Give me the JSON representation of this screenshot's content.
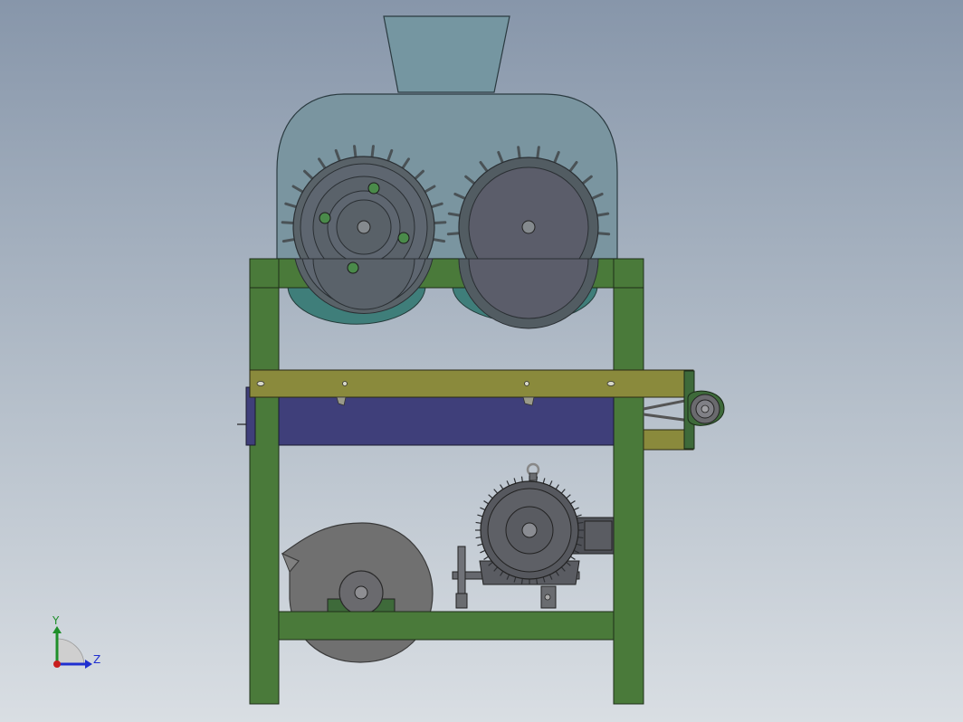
{
  "viewport": {
    "background_top": "#8796aa",
    "background_bottom": "#d9dee3"
  },
  "triad": {
    "y_label": "Y",
    "z_label": "Z",
    "y_color": "#1f8f2a",
    "z_color": "#1f2fd0",
    "origin_color": "#c81e1e"
  },
  "model": {
    "frame_color": "#4a7a3a",
    "crossbar_color": "#8a8a3c",
    "housing_color": "#7a95a0",
    "hopper_color": "#7596a1",
    "lower_shell_color": "#3f7e7a",
    "conveyor_color": "#3f3f7a",
    "motor_color": "#56585e",
    "blower_color": "#707070"
  }
}
